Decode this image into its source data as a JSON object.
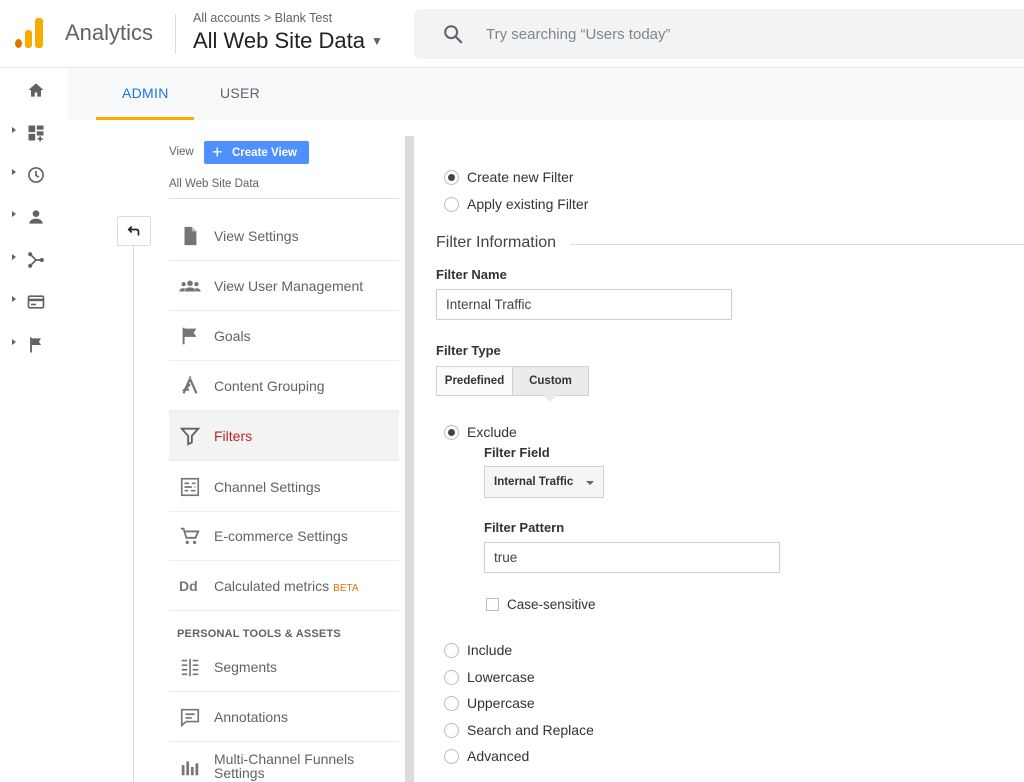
{
  "header": {
    "app_name": "Analytics",
    "breadcrumb": "All accounts > Blank Test",
    "view_title": "All Web Site Data",
    "search_placeholder": "Try searching “Users today”"
  },
  "rail": {
    "items": [
      {
        "icon": "home-icon"
      },
      {
        "icon": "customization-icon"
      },
      {
        "icon": "realtime-clock-icon"
      },
      {
        "icon": "audience-person-icon"
      },
      {
        "icon": "acquisition-icon"
      },
      {
        "icon": "behavior-icon"
      },
      {
        "icon": "conversions-flag-icon"
      }
    ]
  },
  "tabs": {
    "admin": "ADMIN",
    "user": "USER"
  },
  "view_column": {
    "label": "View",
    "create_button": "Create View",
    "view_name": "All Web Site Data",
    "items": [
      {
        "label": "View Settings",
        "icon": "document-icon"
      },
      {
        "label": "View User Management",
        "icon": "users-icon"
      },
      {
        "label": "Goals",
        "icon": "flag-icon"
      },
      {
        "label": "Content Grouping",
        "icon": "content-grouping-icon"
      },
      {
        "label": "Filters",
        "icon": "filter-icon",
        "active": true
      },
      {
        "label": "Channel Settings",
        "icon": "channel-settings-icon"
      },
      {
        "label": "E-commerce Settings",
        "icon": "cart-icon"
      },
      {
        "label": "Calculated metrics",
        "badge": "BETA",
        "icon": "calculated-metrics-icon"
      }
    ],
    "section_title": "PERSONAL TOOLS & ASSETS",
    "personal_items": [
      {
        "label": "Segments",
        "icon": "segments-icon"
      },
      {
        "label": "Annotations",
        "icon": "annotations-icon"
      },
      {
        "label": "Multi-Channel Funnels Settings",
        "icon": "funnels-chart-icon"
      }
    ]
  },
  "form": {
    "mode_options": [
      {
        "label": "Create new Filter",
        "checked": true
      },
      {
        "label": "Apply existing Filter",
        "checked": false
      }
    ],
    "section_title": "Filter Information",
    "filter_name_label": "Filter Name",
    "filter_name_value": "Internal Traffic",
    "filter_type_label": "Filter Type",
    "type_predefined": "Predefined",
    "type_custom": "Custom",
    "exclude_label": "Exclude",
    "filter_field_label": "Filter Field",
    "filter_field_value": "Internal Traffic",
    "filter_pattern_label": "Filter Pattern",
    "filter_pattern_value": "true",
    "case_sensitive_label": "Case-sensitive",
    "other_types": [
      "Include",
      "Lowercase",
      "Uppercase",
      "Search and Replace",
      "Advanced"
    ]
  },
  "colors": {
    "accent_blue": "#1a73e8",
    "tab_underline": "#f9ab00",
    "active_item_text": "#c5221f",
    "create_button": "#4d90fe",
    "beta_badge": "#e37400"
  }
}
